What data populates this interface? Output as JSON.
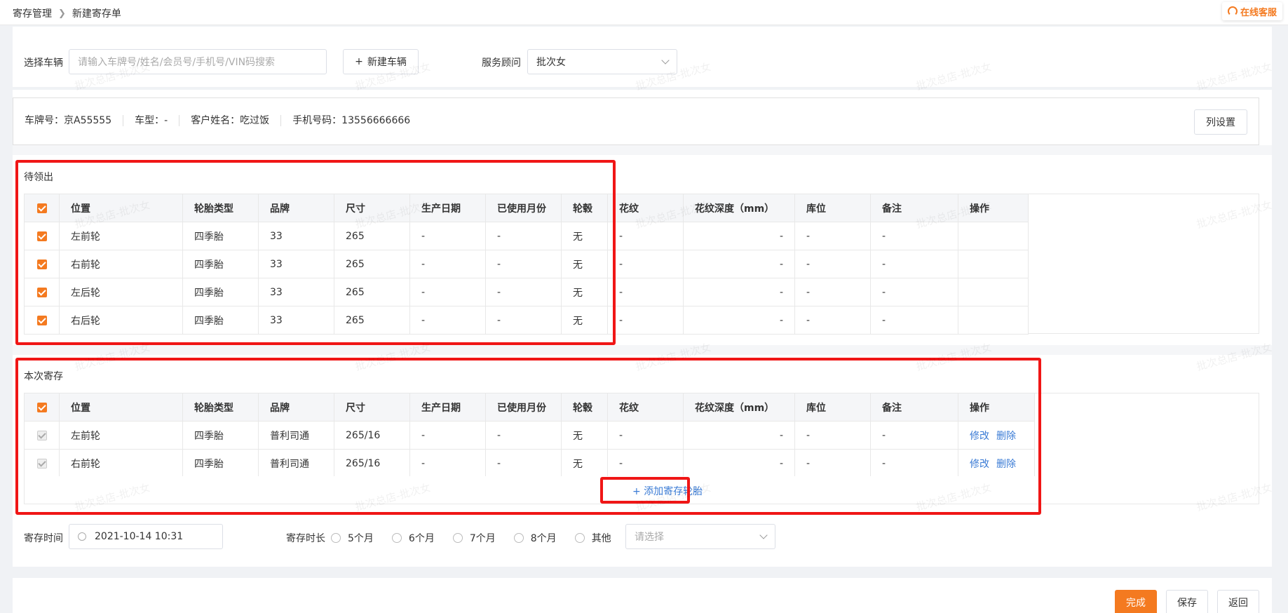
{
  "breadcrumb": {
    "parent": "寄存管理",
    "current": "新建寄存单"
  },
  "online_service": "在线客服",
  "vehicle": {
    "label": "选择车辆",
    "search_placeholder": "请输入车牌号/姓名/会员号/手机号/VIN码搜索",
    "new_button": "新建车辆",
    "advisor_label": "服务顾问",
    "advisor_value": "批次女"
  },
  "info": {
    "plate": "车牌号：京A55555",
    "model": "车型：-",
    "customer": "客户姓名：吃过饭",
    "phone": "手机号码：13556666666",
    "column_settings": "列设置"
  },
  "columns": [
    "位置",
    "轮胎类型",
    "品牌",
    "尺寸",
    "生产日期",
    "已使用月份",
    "轮毂",
    "花纹",
    "花纹深度（mm）",
    "库位",
    "备注",
    "操作"
  ],
  "pending": {
    "title": "待领出",
    "rows": [
      [
        "左前轮",
        "四季胎",
        "33",
        "265",
        "-",
        "-",
        "无",
        "-",
        "-",
        "-",
        "-",
        ""
      ],
      [
        "右前轮",
        "四季胎",
        "33",
        "265",
        "-",
        "-",
        "无",
        "-",
        "-",
        "-",
        "-",
        ""
      ],
      [
        "左后轮",
        "四季胎",
        "33",
        "265",
        "-",
        "-",
        "无",
        "-",
        "-",
        "-",
        "-",
        ""
      ],
      [
        "右后轮",
        "四季胎",
        "33",
        "265",
        "-",
        "-",
        "无",
        "-",
        "-",
        "-",
        "-",
        ""
      ]
    ]
  },
  "current": {
    "title": "本次寄存",
    "rows": [
      [
        "左前轮",
        "四季胎",
        "普利司通",
        "265/16",
        "-",
        "-",
        "无",
        "-",
        "-",
        "-",
        "-"
      ],
      [
        "右前轮",
        "四季胎",
        "普利司通",
        "265/16",
        "-",
        "-",
        "无",
        "-",
        "-",
        "-",
        "-"
      ]
    ],
    "edit_label": "修改",
    "delete_label": "删除",
    "add_label": "添加寄存轮胎"
  },
  "storage": {
    "time_label": "寄存时间",
    "time_value": "2021-10-14 10:31",
    "duration_label": "寄存时长",
    "options": [
      "5个月",
      "6个月",
      "7个月",
      "8个月",
      "其他"
    ],
    "other_placeholder": "请选择"
  },
  "footer": {
    "finish": "完成",
    "save": "保存",
    "back": "返回"
  },
  "watermark": "批次总店-批次女"
}
